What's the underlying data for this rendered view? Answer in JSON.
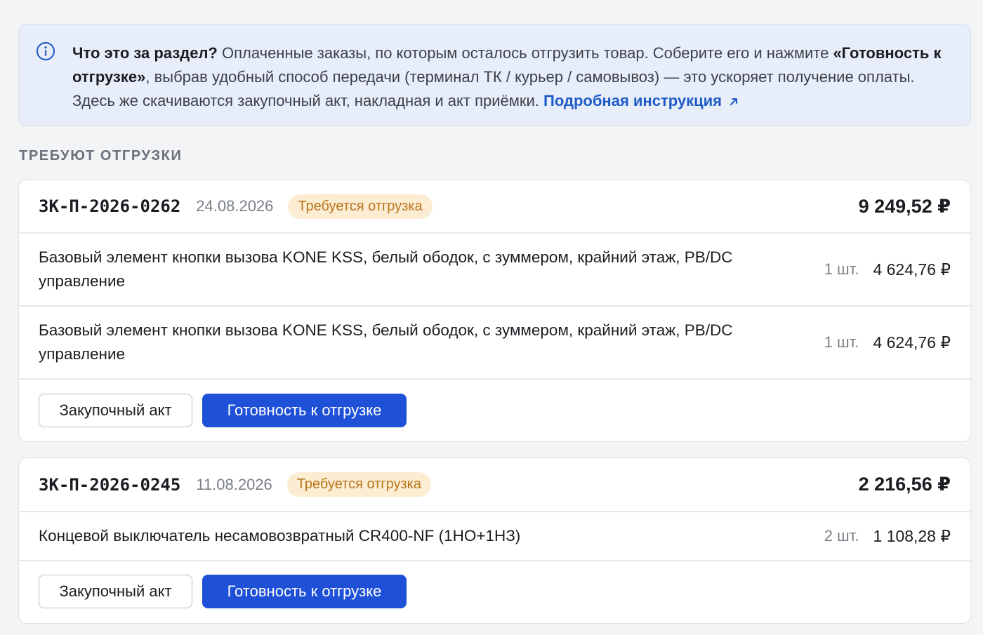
{
  "info": {
    "icon": "info-circle-icon",
    "lead": "Что это за раздел?",
    "text1": " Оплаченные заказы, по которым осталось отгрузить товар. Соберите его и нажмите ",
    "action_name": "«Готовность к отгрузке»",
    "text2": ", выбрав удобный способ передачи (терминал ТК / курьер / самовывоз) — это ускоряет получение оплаты. Здесь же скачиваются закупочный акт, накладная и акт приёмки. ",
    "link_label": "Подробная инструкция",
    "link_icon": "external-arrow-icon"
  },
  "section_title": "ТРЕБУЮТ ОТГРУЗКИ",
  "colors": {
    "accent": "#1e50d8",
    "link": "#1f5bc7",
    "badge_bg": "#fbecd2",
    "badge_text": "#b9761c"
  },
  "orders": [
    {
      "id": "ЗК-П-2026-0262",
      "date": "24.08.2026",
      "status": "Требуется отгрузка",
      "total": "9 249,52 ₽",
      "items": [
        {
          "name": "Базовый элемент кнопки вызова KONE KSS, белый ободок, с зуммером, крайний этаж, PB/DC управление",
          "qty": "1 шт.",
          "price": "4 624,76 ₽"
        },
        {
          "name": "Базовый элемент кнопки вызова KONE KSS, белый ободок, с зуммером, крайний этаж, PB/DC управление",
          "qty": "1 шт.",
          "price": "4 624,76 ₽"
        }
      ],
      "actions": {
        "act": "Закупочный акт",
        "ready": "Готовность к отгрузке"
      }
    },
    {
      "id": "ЗК-П-2026-0245",
      "date": "11.08.2026",
      "status": "Требуется отгрузка",
      "total": "2 216,56 ₽",
      "items": [
        {
          "name": "Концевой выключатель несамовозвратный CR400-NF (1НО+1НЗ)",
          "qty": "2 шт.",
          "price": "1 108,28 ₽"
        }
      ],
      "actions": {
        "act": "Закупочный акт",
        "ready": "Готовность к отгрузке"
      }
    }
  ]
}
